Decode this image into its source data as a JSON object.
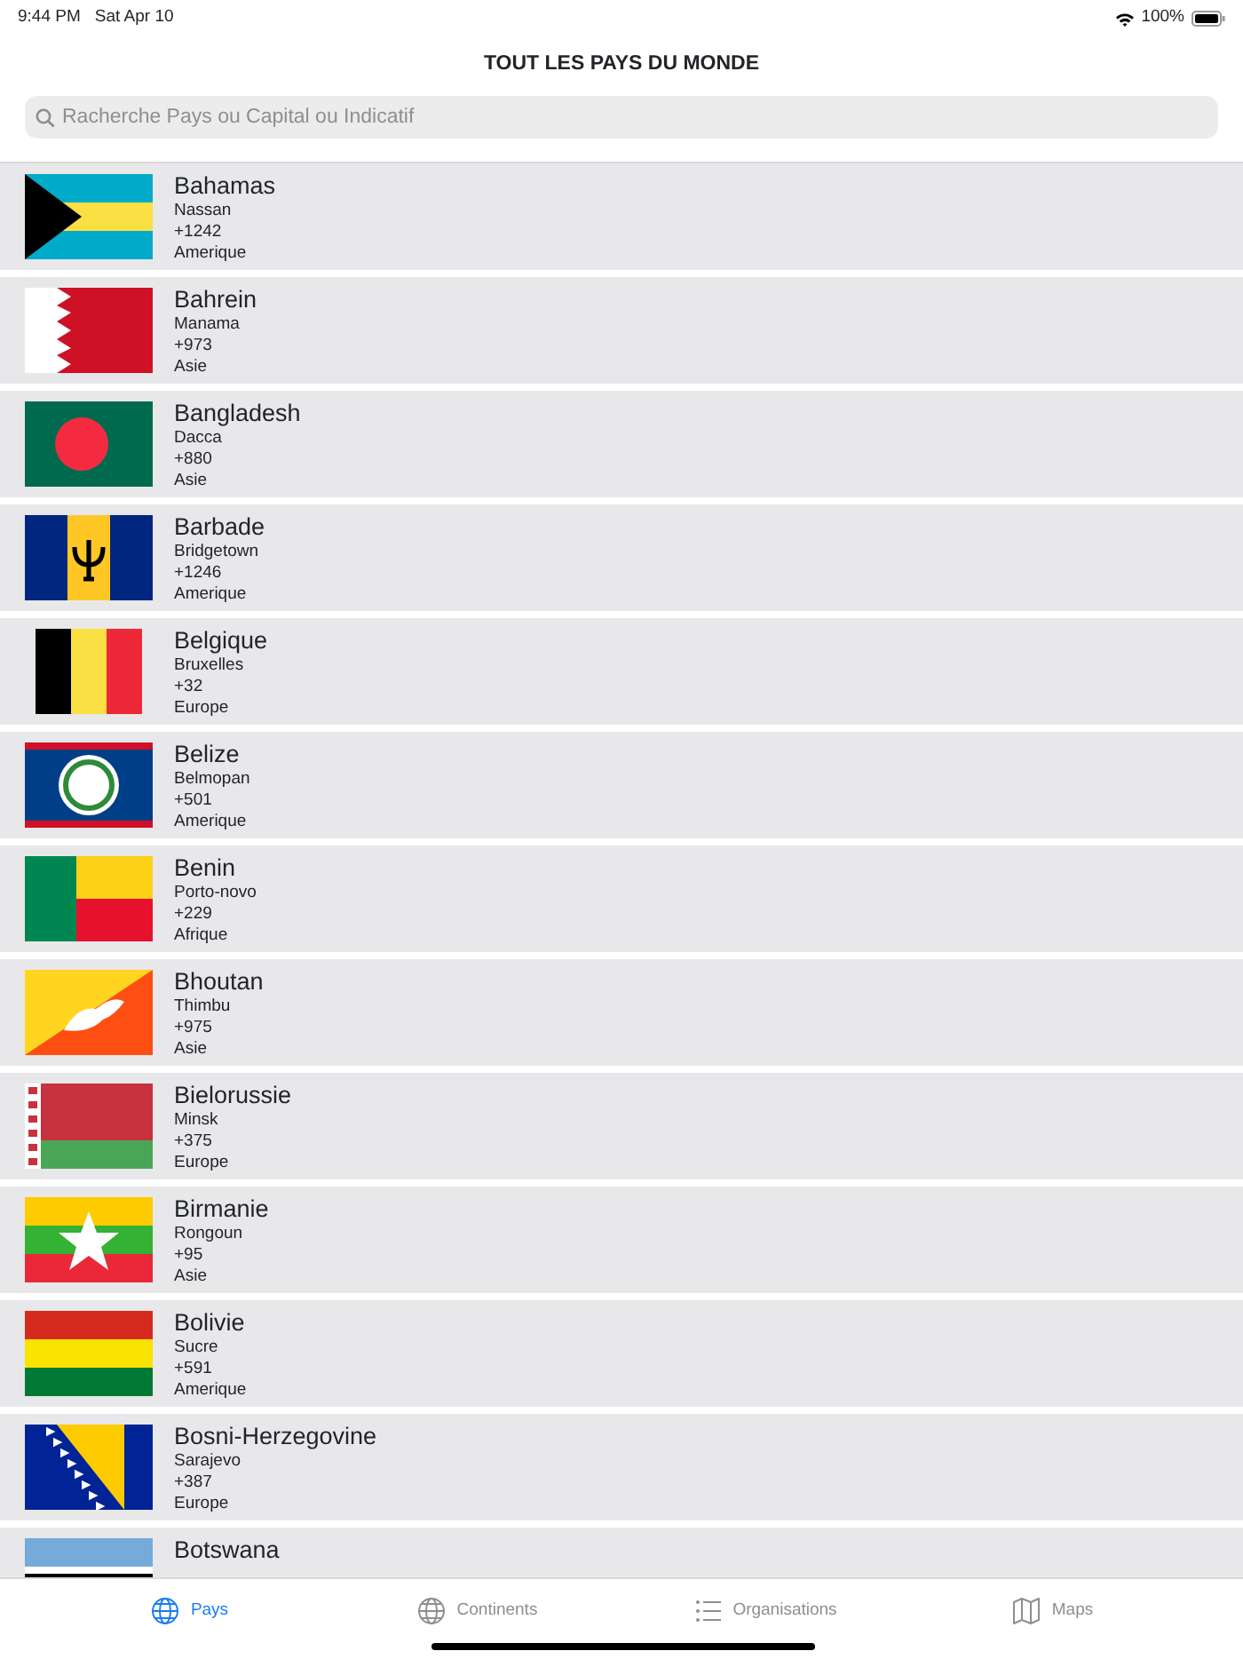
{
  "status_bar": {
    "time": "9:44 PM",
    "date": "Sat Apr 10",
    "battery": "100%"
  },
  "title": "TOUT LES PAYS DU MONDE",
  "search": {
    "placeholder": "Racherche Pays ou Capital ou Indicatif"
  },
  "countries": [
    {
      "name": "Bahamas",
      "capital": "Nassan",
      "code": "+1242",
      "continent": "Amerique"
    },
    {
      "name": "Bahrein",
      "capital": "Manama",
      "code": "+973",
      "continent": "Asie"
    },
    {
      "name": "Bangladesh",
      "capital": "Dacca",
      "code": "+880",
      "continent": "Asie"
    },
    {
      "name": "Barbade",
      "capital": "Bridgetown",
      "code": "+1246",
      "continent": "Amerique"
    },
    {
      "name": "Belgique",
      "capital": "Bruxelles",
      "code": "+32",
      "continent": "Europe"
    },
    {
      "name": "Belize",
      "capital": "Belmopan",
      "code": "+501",
      "continent": "Amerique"
    },
    {
      "name": "Benin",
      "capital": "Porto-novo",
      "code": "+229",
      "continent": "Afrique"
    },
    {
      "name": "Bhoutan",
      "capital": "Thimbu",
      "code": "+975",
      "continent": "Asie"
    },
    {
      "name": "Bielorussie",
      "capital": "Minsk",
      "code": "+375",
      "continent": "Europe"
    },
    {
      "name": "Birmanie",
      "capital": "Rongoun",
      "code": "+95",
      "continent": "Asie"
    },
    {
      "name": "Bolivie",
      "capital": "Sucre",
      "code": "+591",
      "continent": "Amerique"
    },
    {
      "name": "Bosni-Herzegovine",
      "capital": "Sarajevo",
      "code": "+387",
      "continent": "Europe"
    },
    {
      "name": "Botswana"
    }
  ],
  "tabs": [
    {
      "label": "Pays",
      "kind": "globe",
      "selected": true
    },
    {
      "label": "Continents",
      "kind": "globe",
      "selected": false
    },
    {
      "label": "Organisations",
      "kind": "list",
      "selected": false
    },
    {
      "label": "Maps",
      "kind": "map",
      "selected": false
    }
  ]
}
